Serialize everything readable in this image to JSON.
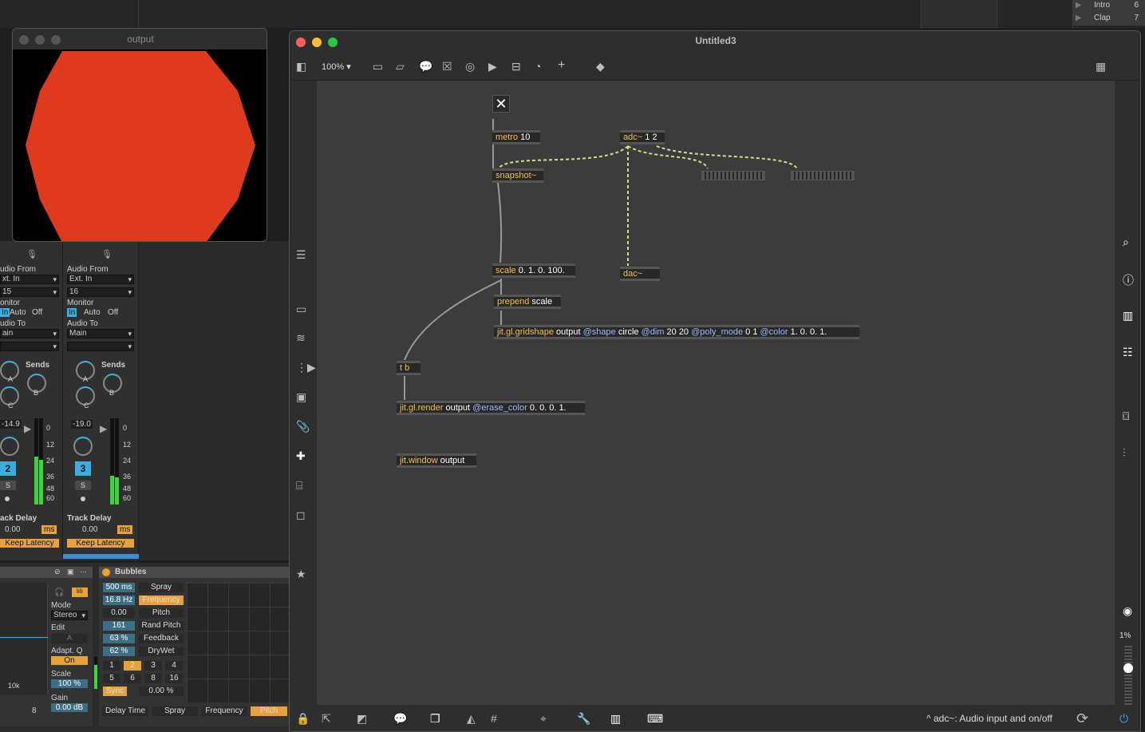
{
  "background": {
    "top_right_items": [
      {
        "label": "Intro",
        "num": "6"
      },
      {
        "label": "Clap",
        "num": "7"
      }
    ]
  },
  "output_window": {
    "title": "output",
    "circle_color": "#e03a1e"
  },
  "mixer": {
    "strips": [
      {
        "audio_from_label": "udio From",
        "audio_from": "xt. In",
        "channel": "15",
        "monitor_label": "onitor",
        "monitor_in": "In",
        "monitor_auto": "Auto",
        "monitor_off": "Off",
        "audio_to_label": "udio To",
        "audio_to": "ain",
        "sends_label": "Sends",
        "send_a": "A",
        "send_b": "B",
        "send_c": "C",
        "volume": "-14.9",
        "track_num": "2",
        "solo": "S",
        "db_marks": [
          "0",
          "12",
          "24",
          "36",
          "48",
          "60"
        ],
        "track_delay_label": "ack Delay",
        "track_delay": "0.00",
        "ms": "ms",
        "keep_latency": "Keep Latency"
      },
      {
        "audio_from_label": "Audio From",
        "audio_from": "Ext. In",
        "channel": "16",
        "monitor_label": "Monitor",
        "monitor_in": "In",
        "monitor_auto": "Auto",
        "monitor_off": "Off",
        "audio_to_label": "Audio To",
        "audio_to": "Main",
        "sends_label": "Sends",
        "send_a": "A",
        "send_b": "B",
        "send_c": "C",
        "volume": "-19.0",
        "track_num": "3",
        "solo": "S",
        "db_marks": [
          "0",
          "12",
          "24",
          "36",
          "48",
          "60"
        ],
        "track_delay_label": "Track Delay",
        "track_delay": "0.00",
        "ms": "ms",
        "keep_latency": "Keep Latency"
      }
    ]
  },
  "eq_device": {
    "mode_label": "Mode",
    "mode": "Stereo",
    "edit_label": "Edit",
    "edit_value": "A",
    "adaptq_label": "Adapt. Q",
    "adaptq": "On",
    "scale_label": "Scale",
    "scale": "100 %",
    "gain_label": "Gain",
    "gain": "0.00 dB",
    "freq_mark": "10k",
    "num": "8"
  },
  "bubbles": {
    "name": "Bubbles",
    "params": [
      {
        "value": "500 ms",
        "label": "Spray"
      },
      {
        "value": "16.8 Hz",
        "label": "Frequency"
      },
      {
        "value": "0.00",
        "label": "Pitch"
      },
      {
        "value": "161",
        "label": "Rand Pitch"
      },
      {
        "value": "63 %",
        "label": "Feedback"
      },
      {
        "value": "62 %",
        "label": "DryWet"
      }
    ],
    "grid": [
      "1",
      "2",
      "3",
      "4",
      "5",
      "6",
      "8",
      "16"
    ],
    "sync": "Sync",
    "sync_value": "0.00 %",
    "tabs": [
      "Delay Time",
      "Spray",
      "Frequency",
      "Pitch"
    ]
  },
  "max_window": {
    "title": "Untitled3",
    "zoom": "100%",
    "status": "adc~: Audio input and on/off",
    "cpu": "1%",
    "objects": {
      "metro": {
        "cls": "metro",
        "args": " 10"
      },
      "adc": {
        "cls": "adc~",
        "args": " 1 2"
      },
      "snapshot": {
        "cls": "snapshot~",
        "args": ""
      },
      "scale": {
        "cls": "scale",
        "args": " 0. 1. 0. 100."
      },
      "dac": {
        "cls": "dac~",
        "args": ""
      },
      "prepend": {
        "cls": "prepend",
        "args": " scale"
      },
      "gridshape": {
        "cls": "jit.gl.gridshape",
        "a1": " output ",
        "at1": "@shape",
        "a2": " circle ",
        "at2": "@dim",
        "a3": " 20 20 ",
        "at3": "@poly_mode",
        "a4": " 0 1 ",
        "at4": "@color",
        "a5": " 1. 0. 0. 1."
      },
      "tb": {
        "cls": "t b",
        "args": ""
      },
      "render": {
        "cls": "jit.gl.render",
        "a1": " output ",
        "at1": "@erase_color",
        "a2": " 0. 0. 0. 1."
      },
      "window": {
        "cls": "jit.window",
        "args": " output"
      }
    }
  }
}
